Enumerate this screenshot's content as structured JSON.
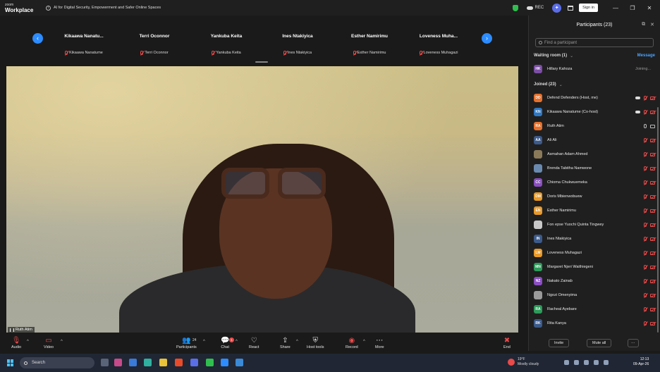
{
  "app": {
    "brand_top": "zoom",
    "brand_bottom": "Workplace",
    "meeting_title": "AI for Digital Security, Empowerment and Safer Online Spaces",
    "rec_label": "REC",
    "signin_label": "Sign in",
    "avatar_initial": "✦"
  },
  "gallery": {
    "tiles": [
      {
        "name": "Kikaawa  Nanatu...",
        "label": "Kikaawa Nanatume"
      },
      {
        "name": "Terri Oconnor",
        "label": "Terri Oconnor"
      },
      {
        "name": "Yankuba Keita",
        "label": "Yankuba Keita"
      },
      {
        "name": "Ines Ntakiyica",
        "label": "Ines Ntakiyica"
      },
      {
        "name": "Esther Namirimu",
        "label": "Esther Namirimu"
      },
      {
        "name": "Loveness  Muha...",
        "label": "Loveness Muhagazi"
      }
    ]
  },
  "video": {
    "speaker_label": "Ruth Atim"
  },
  "participants": {
    "title": "Participants (23)",
    "search_placeholder": "Find a participant",
    "waiting_label": "Waiting room (1)",
    "message_label": "Message",
    "waiting": [
      {
        "initials": "HK",
        "name": "Hillary Kahoza",
        "status": "Joining...",
        "color": "#7b4ea3"
      }
    ],
    "joined_label": "Joined (23)",
    "joined": [
      {
        "initials": "DD",
        "name": "Defend Defenders (Host, me)",
        "color": "#e8702a",
        "cloud": true,
        "mic": "red",
        "cam": "red"
      },
      {
        "initials": "KN",
        "name": "Kikaawa Nanatume (Co-host)",
        "color": "#2f78c4",
        "cloud": true,
        "mic": "red",
        "cam": "red"
      },
      {
        "initials": "RA",
        "name": "Ruth Atim",
        "color": "#e8702a",
        "cloud": false,
        "mic": "gray",
        "cam": "gray"
      },
      {
        "initials": "AA",
        "name": "Ali Ali",
        "color": "#3c5a8a",
        "cloud": false,
        "mic": "red",
        "cam": "red"
      },
      {
        "initials": "",
        "name": "Asmahan Adam Ahmed",
        "color": "#8a7a5a",
        "cloud": false,
        "mic": "red",
        "cam": "red"
      },
      {
        "initials": "",
        "name": "Brenda Tabitha Namwone",
        "color": "#6a8ab0",
        "cloud": false,
        "mic": "red",
        "cam": "red"
      },
      {
        "initials": "CC",
        "name": "Chioma Chukwuemeka",
        "color": "#8a4ec0",
        "cloud": false,
        "mic": "red",
        "cam": "red"
      },
      {
        "initials": "DM",
        "name": "Doris Mbienwobuew",
        "color": "#e89a2a",
        "cloud": false,
        "mic": "red",
        "cam": "red"
      },
      {
        "initials": "EN",
        "name": "Esther Namirimu",
        "color": "#e89a2a",
        "cloud": false,
        "mic": "red",
        "cam": "red"
      },
      {
        "initials": "",
        "name": "Fon epse Yuochi Quinta Tingwey",
        "color": "#c8c8c8",
        "cloud": false,
        "mic": "red",
        "cam": "red"
      },
      {
        "initials": "IN",
        "name": "Ines Ntakiyica",
        "color": "#3c5a8a",
        "cloud": false,
        "mic": "red",
        "cam": "red"
      },
      {
        "initials": "LM",
        "name": "Loveness Muhagazi",
        "color": "#e89a2a",
        "cloud": false,
        "mic": "red",
        "cam": "red"
      },
      {
        "initials": "MN",
        "name": "Margaret Njeri Waithiegeni",
        "color": "#2e9a5a",
        "cloud": false,
        "mic": "red",
        "cam": "red"
      },
      {
        "initials": "NZ",
        "name": "Nakato Zainab",
        "color": "#8a4ec0",
        "cloud": false,
        "mic": "red",
        "cam": "red"
      },
      {
        "initials": "",
        "name": "Ngozi Omenyima",
        "color": "#9a9a9a",
        "cloud": false,
        "mic": "red",
        "cam": "red"
      },
      {
        "initials": "RA",
        "name": "Racheal Ayebare",
        "color": "#2e9a5a",
        "cloud": false,
        "mic": "red",
        "cam": "red"
      },
      {
        "initials": "RK",
        "name": "Rita Kanya",
        "color": "#3c5a8a",
        "cloud": false,
        "mic": "red",
        "cam": "red"
      }
    ],
    "invite_label": "Invite",
    "muteall_label": "Mute all",
    "more_label": "···"
  },
  "toolbar": {
    "audio_label": "Audio",
    "video_label": "Video",
    "participants_label": "Participants",
    "participants_count": "24",
    "chat_label": "Chat",
    "chat_badge": "1",
    "react_label": "React",
    "share_label": "Share",
    "hosttools_label": "Host tools",
    "record_label": "Record",
    "more_label": "More",
    "end_label": "End"
  },
  "taskbar": {
    "search_label": "Search",
    "weather_temp": "19°F",
    "weather_desc": "Mostly cloudy",
    "time": "12:13",
    "date": "09-Apr-26"
  }
}
